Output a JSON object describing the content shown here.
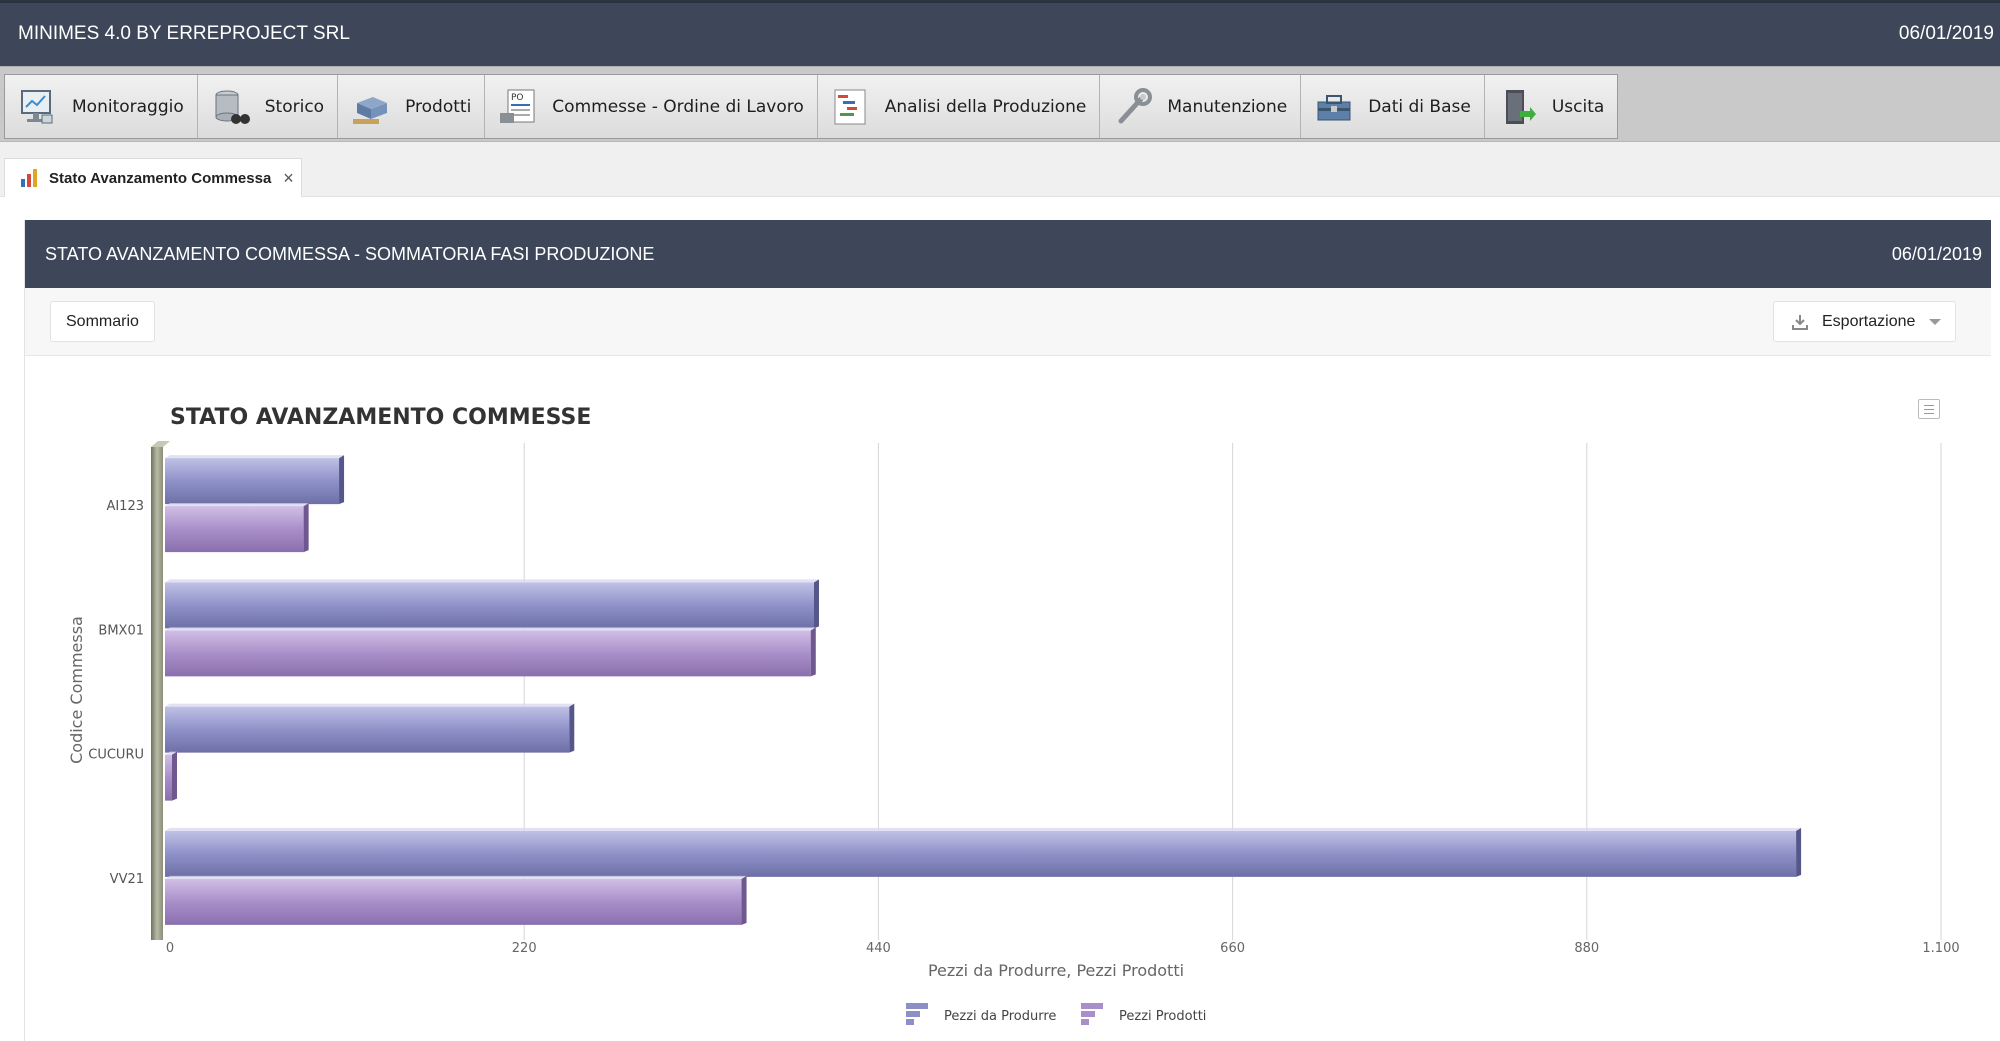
{
  "app": {
    "title": "MINIMES 4.0 BY ERREPROJECT SRL",
    "date": "06/01/2019"
  },
  "menu": {
    "items": [
      {
        "label": "Monitoraggio",
        "icon": "monitor-icon"
      },
      {
        "label": "Storico",
        "icon": "database-binoculars-icon"
      },
      {
        "label": "Prodotti",
        "icon": "pallet-box-icon"
      },
      {
        "label": "Commesse - Ordine di Lavoro",
        "icon": "purchase-order-icon"
      },
      {
        "label": "Analisi della Produzione",
        "icon": "gantt-icon"
      },
      {
        "label": "Manutenzione",
        "icon": "wrench-icon"
      },
      {
        "label": "Dati di Base",
        "icon": "toolbox-icon"
      },
      {
        "label": "Uscita",
        "icon": "exit-door-icon"
      }
    ]
  },
  "tab": {
    "label": "Stato Avanzamento Commessa",
    "close": "×",
    "icon": "bar-chart-icon"
  },
  "panel": {
    "title": "STATO AVANZAMENTO COMMESSA - SOMMATORIA FASI PRODUZIONE",
    "date": "06/01/2019",
    "summary_button": "Sommario",
    "export_button": "Esportazione"
  },
  "colors": {
    "header": "#3d4759",
    "series1": "#8d8fc9",
    "series2": "#a98fc9",
    "axis_wall": "#9ea08c"
  },
  "chart_data": {
    "type": "bar",
    "orientation": "horizontal",
    "title": "STATO AVANZAMENTO COMMESSE",
    "xlabel": "Pezzi da Produrre, Pezzi Prodotti",
    "ylabel": "Codice Commessa",
    "categories": [
      "AI123",
      "BMX01",
      "CUCURU",
      "VV21"
    ],
    "series": [
      {
        "name": "Pezzi da Produrre",
        "values": [
          105,
          400,
          248,
          1010
        ]
      },
      {
        "name": "Pezzi Prodotti",
        "values": [
          83,
          398,
          0,
          355
        ]
      }
    ],
    "xlim": [
      0,
      1100
    ],
    "ticks": [
      0,
      220,
      440,
      660,
      880,
      1100
    ],
    "tick_labels": [
      "0",
      "220",
      "440",
      "660",
      "880",
      "1.100"
    ],
    "grid": true,
    "legend": "bottom-center"
  }
}
